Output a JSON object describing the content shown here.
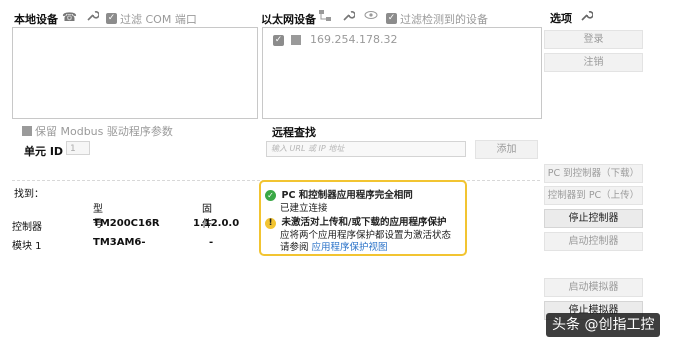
{
  "local": {
    "title": "本地设备",
    "filter_label": "过滤 COM 端口",
    "phone_icon": "phone-icon",
    "wrench_icon": "wrench-icon",
    "keep_modbus_label": "保留 Modbus 驱动程序参数",
    "unit_id_label": "单元 ID",
    "unit_id_value": "1"
  },
  "ethernet": {
    "title": "以太网设备",
    "filter_label": "过滤检测到的设备",
    "devices": [
      "169.254.178.32"
    ]
  },
  "remote": {
    "title": "远程查找",
    "placeholder": "输入 URL 或 IP 地址",
    "add_label": "添加"
  },
  "options": {
    "title": "选项",
    "login": "登录",
    "logout": "注销",
    "pc_to_controller": "PC 到控制器（下载）",
    "controller_to_pc": "控制器到 PC（上传）",
    "stop_controller": "停止控制器",
    "start_controller": "启动控制器",
    "start_simulator": "启动模拟器",
    "stop_simulator": "停止模拟器"
  },
  "found": {
    "label": "找到：",
    "headers": [
      "型号",
      "固件"
    ],
    "rows": [
      {
        "name": "控制器",
        "model": "TM200C16R",
        "firmware": "1.12.0.0"
      },
      {
        "name": "模块 1",
        "model": "TM3AM6-",
        "firmware": "-"
      }
    ]
  },
  "status": {
    "match_text": "PC 和控制器应用程序完全相同",
    "connected_text": "已建立连接",
    "warn_title": "未激活对上传和/或下载的应用程序保护",
    "warn_line1": "应将两个应用程序保护都设置为激活状态",
    "warn_line2_prefix": "请参阅",
    "warn_link": "应用程序保护视图"
  },
  "watermark": "头条 @创指工控",
  "colors": {
    "status_border": "#f2c431",
    "ok": "#3aa845",
    "link": "#2a72c8"
  }
}
